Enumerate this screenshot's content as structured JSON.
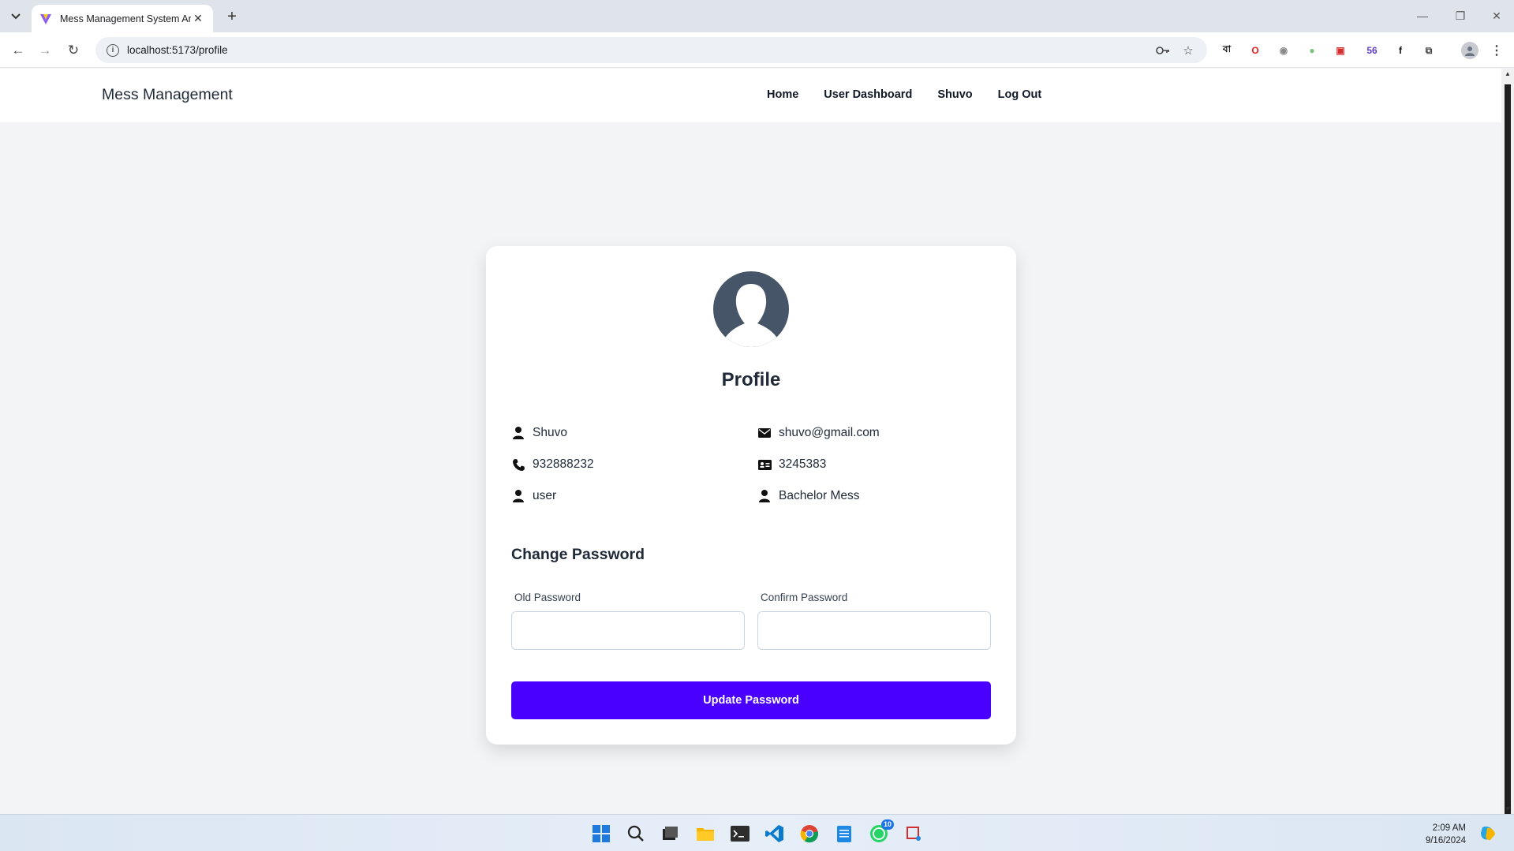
{
  "browser": {
    "tab_title": "Mess Management System Arm",
    "url": "localhost:5173/profile",
    "extensions": [
      {
        "name": "bangla-extension-icon",
        "glyph": "বা",
        "color": "#111111"
      },
      {
        "name": "opera-extension-icon",
        "glyph": "O",
        "color": "#e0201b"
      },
      {
        "name": "camera-extension-icon",
        "glyph": "◉",
        "color": "#888888"
      },
      {
        "name": "color-extension-icon",
        "glyph": "●",
        "color": "#7ac17a"
      },
      {
        "name": "pdf-extension-icon",
        "glyph": "▣",
        "color": "#d32f2f"
      },
      {
        "name": "github-extension-icon",
        "glyph": "56",
        "color": "#5f3dc4"
      },
      {
        "name": "font-extension-icon",
        "glyph": "f",
        "color": "#111111"
      },
      {
        "name": "puzzle-extensions-icon",
        "glyph": "⧉",
        "color": "#444444"
      }
    ]
  },
  "navbar": {
    "brand": "Mess Management",
    "links": [
      "Home",
      "User Dashboard",
      "Shuvo",
      "Log Out"
    ]
  },
  "profile": {
    "title": "Profile",
    "name": "Shuvo",
    "email": "shuvo@gmail.com",
    "phone": "932888232",
    "id_number": "3245383",
    "role": "user",
    "mess": "Bachelor Mess"
  },
  "password_form": {
    "title": "Change Password",
    "old_label": "Old Password",
    "old_value": "",
    "confirm_label": "Confirm Password",
    "confirm_value": "",
    "button_label": "Update Password"
  },
  "colors": {
    "accent": "#4a00ff",
    "avatar": "#475569",
    "page_bg": "#f3f4f6"
  },
  "taskbar": {
    "time": "2:09 AM",
    "date": "9/16/2024",
    "whatsapp_badge": "10"
  }
}
